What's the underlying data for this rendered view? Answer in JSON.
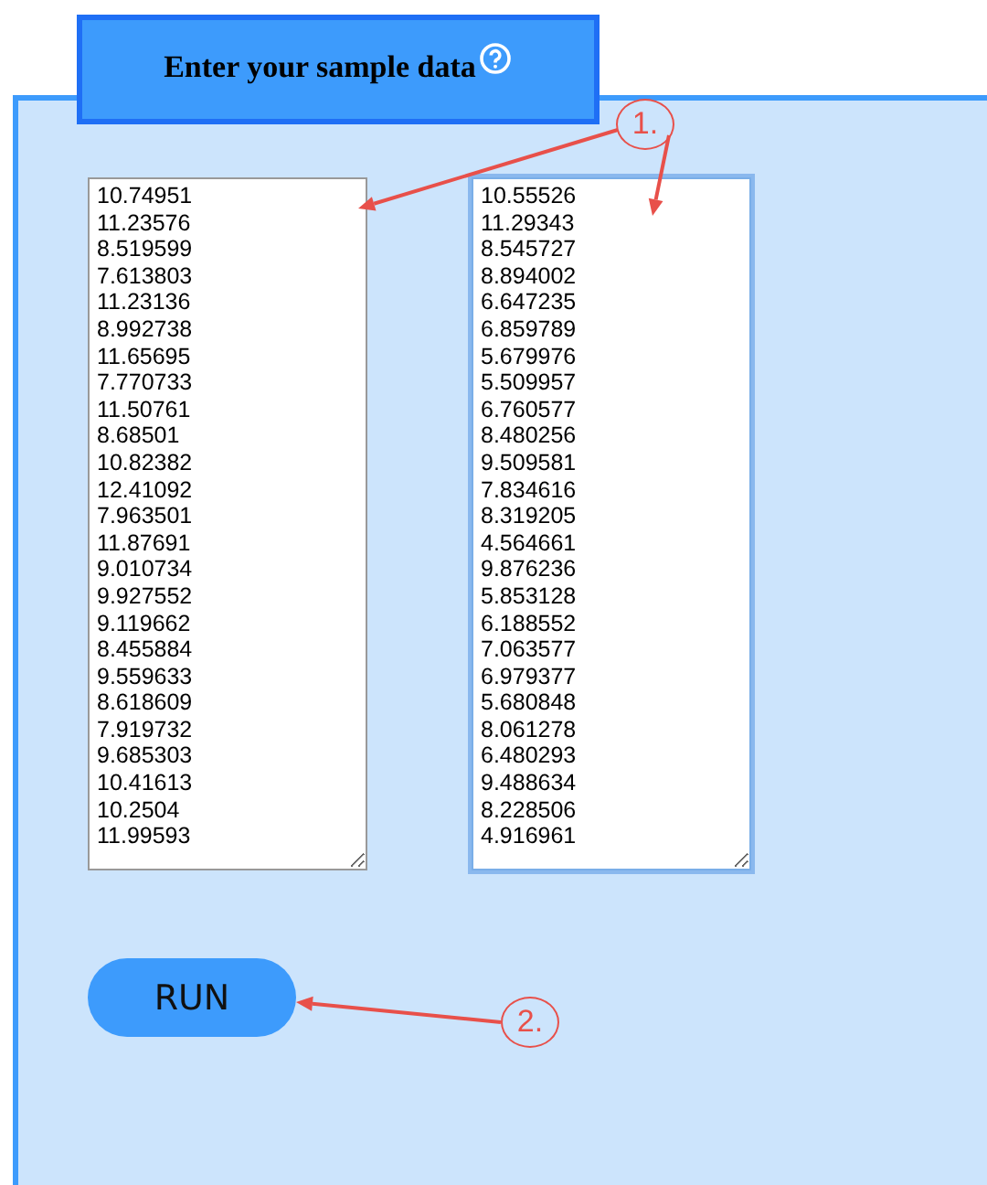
{
  "header": {
    "title": "Enter your sample data"
  },
  "samples": [
    {
      "focused": false,
      "values": [
        "10.74951",
        "11.23576",
        "8.519599",
        "7.613803",
        "11.23136",
        "8.992738",
        "11.65695",
        "7.770733",
        "11.50761",
        "8.68501",
        "10.82382",
        "12.41092",
        "7.963501",
        "11.87691",
        "9.010734",
        "9.927552",
        "9.119662",
        "8.455884",
        "9.559633",
        "8.618609",
        "7.919732",
        "9.685303",
        "10.41613",
        "10.2504",
        "11.99593"
      ]
    },
    {
      "focused": true,
      "values": [
        "10.55526",
        "11.29343",
        "8.545727",
        "8.894002",
        "6.647235",
        "6.859789",
        "5.679976",
        "5.509957",
        "6.760577",
        "8.480256",
        "9.509581",
        "7.834616",
        "8.319205",
        "4.564661",
        "9.876236",
        "5.853128",
        "6.188552",
        "7.063577",
        "6.979377",
        "5.680848",
        "8.061278",
        "6.480293",
        "9.488634",
        "8.228506",
        "4.916961"
      ]
    }
  ],
  "run_button": {
    "label": "RUN"
  },
  "callouts": [
    {
      "label": "1."
    },
    {
      "label": "2."
    }
  ]
}
